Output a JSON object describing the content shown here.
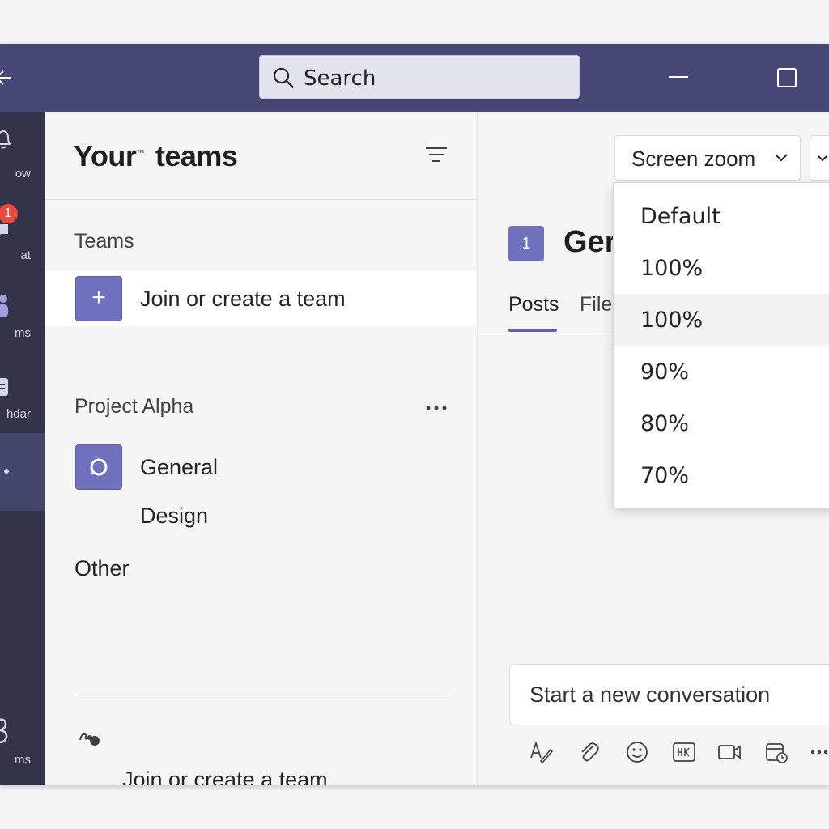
{
  "titlebar": {
    "search_placeholder": "Search"
  },
  "rail": {
    "items": [
      {
        "label": "ow",
        "icon": "bell-icon"
      },
      {
        "label": "at",
        "icon": "chat-icon",
        "badge": "1"
      },
      {
        "label": "ms",
        "icon": "teams-icon"
      },
      {
        "label": "hdar",
        "icon": "calendar-icon"
      },
      {
        "label": "",
        "icon": "more-apps-icon"
      },
      {
        "label": "ms",
        "icon": "apps-icon"
      }
    ]
  },
  "teams_panel": {
    "title_part1": "Your",
    "title_mark": "™",
    "title_part2": "teams",
    "section_teams": "Teams",
    "join_create": "Join or create a team",
    "team_name": "Project Alpha",
    "channels": [
      "General",
      "Design"
    ],
    "section_other": "Other",
    "footer_join": "Join or create a team"
  },
  "content": {
    "zoom_label": "Screen zoom",
    "channel_number": "1",
    "channel_name": "Ger",
    "tabs": [
      "Posts",
      "File"
    ],
    "compose_placeholder": "Start a new conversation"
  },
  "zoom_dropdown": {
    "options": [
      "Default",
      "100%",
      "100%",
      "90%",
      "80%",
      "70%"
    ],
    "highlighted_index": 2
  },
  "colors": {
    "titlebar": "#464775",
    "rail": "#33344a",
    "accent": "#6264a7",
    "tile": "#6f71bd",
    "badge": "#e74b3c"
  }
}
